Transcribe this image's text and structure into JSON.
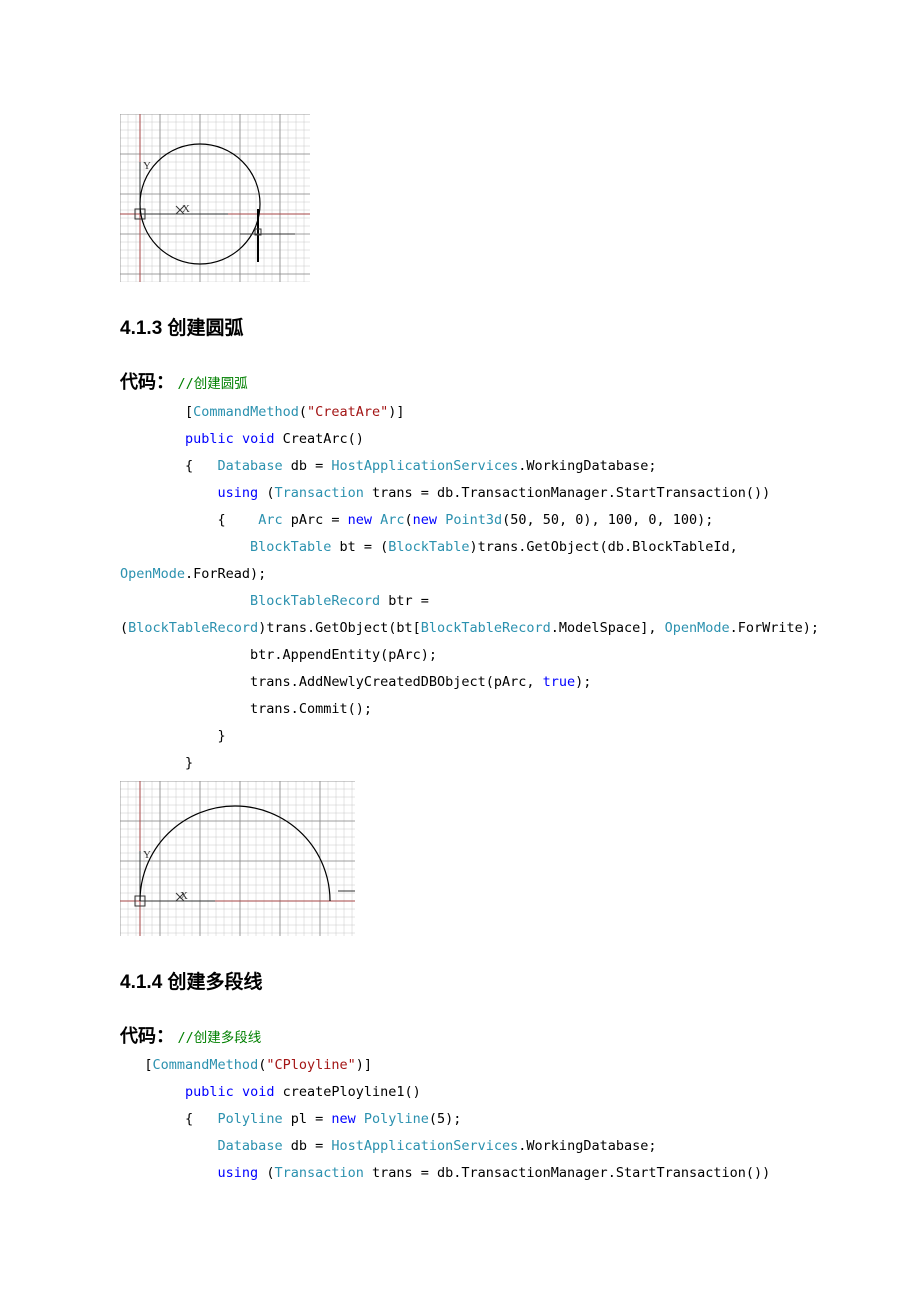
{
  "section413": {
    "heading": "4.1.3 创建圆弧",
    "codeLabel": "代码：",
    "comment": "//创建圆弧",
    "code": {
      "attr_open": "[",
      "CommandMethod": "CommandMethod",
      "attr_str": "\"CreatAre\"",
      "attr_close": ")]",
      "public": "public",
      "void": "void",
      "fnName": " CreatArc()",
      "lbrace": "{   ",
      "Database": "Database",
      "db_eq": " db = ",
      "HostApp": "HostApplicationServices",
      "WorkingDb": ".WorkingDatabase;",
      "using": "using",
      "paren_open": " (",
      "Transaction": "Transaction",
      "trans_line": " trans = db.TransactionManager.StartTransaction())",
      "lbrace2": "{    ",
      "Arc": "Arc",
      "pArc_eq": " pArc = ",
      "new1": "new",
      "Arc2": "Arc",
      "paren2": "(",
      "new2": "new",
      "Point3d": "Point3d",
      "pt_args": "(50, 50, 0), 100, 0, 100);",
      "BlockTable": "BlockTable",
      "bt_eq": " bt = (",
      "BlockTable2": "BlockTable",
      "bt_line": ")trans.GetObject(db.BlockTableId, ",
      "OpenMode": "OpenMode",
      "ForRead": ".ForRead);",
      "BlockTableRecord": "BlockTableRecord",
      "btr_eq": " btr = ",
      "cast_open": "(",
      "BlockTableRecord2": "BlockTableRecord",
      "btr_line_a": ")trans.GetObject(bt[",
      "BlockTableRecord3": "BlockTableRecord",
      "ModelSpace": ".ModelSpace], ",
      "OpenMode2": "OpenMode",
      "ForWrite": ".ForWrite);",
      "append": "btr.AppendEntity(pArc);",
      "addNewly_a": "trans.AddNewlyCreatedDBObject(pArc, ",
      "true": "true",
      "addNewly_b": ");",
      "commit": "trans.Commit();",
      "rbrace2": "}",
      "rbrace": "}"
    }
  },
  "section414": {
    "heading": "4.1.4 创建多段线",
    "codeLabel": "代码：",
    "comment": "//创建多段线",
    "code": {
      "attr_open": "[",
      "CommandMethod": "CommandMethod",
      "attr_str": "\"CPloyline\"",
      "attr_close": ")]",
      "public": "public",
      "void": "void",
      "fnName": " createPloyline1()",
      "lbrace": "{   ",
      "Polyline": "Polyline",
      "pl_eq": " pl = ",
      "new1": "new",
      "Polyline2": "Polyline",
      "pl_args": "(5);",
      "Database": "Database",
      "db_eq": " db = ",
      "HostApp": "HostApplicationServices",
      "WorkingDb": ".WorkingDatabase;",
      "using": "using",
      "paren_open": " (",
      "Transaction": "Transaction",
      "trans_line": " trans = db.TransactionManager.StartTransaction())"
    }
  },
  "fig1": {
    "ylabel": "Y",
    "xlabel": "X"
  },
  "fig2": {
    "ylabel": "Y",
    "xlabel": "X"
  }
}
